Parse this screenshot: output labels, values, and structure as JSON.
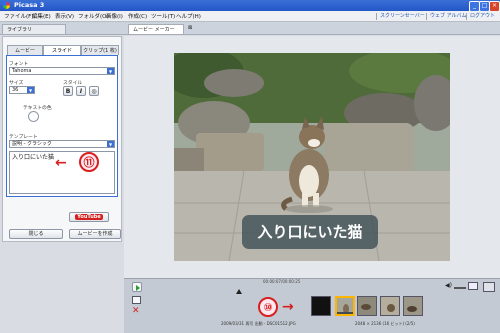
{
  "window": {
    "title": "Picasa 3"
  },
  "menu": {
    "items": [
      "ファイル(F)",
      "編集(E)",
      "表示(V)",
      "フォルダ(O)",
      "画像(I)",
      "作成(C)",
      "ツール(T)",
      "ヘルプ(H)"
    ],
    "links": [
      "スクリーンセーバー",
      "ウェブ アルバム",
      "ログアウト"
    ]
  },
  "doc_tabs": {
    "library": "ライブラリ",
    "movie_maker": "ムービー メーカー"
  },
  "panel": {
    "tabs": [
      "ムービー",
      "スライド",
      "クリップ(1 枚)"
    ],
    "font_label": "フォント",
    "font_value": "Tahoma",
    "size_label": "サイズ",
    "size_value": "36",
    "style_label": "スタイル",
    "style_buttons": [
      "B",
      "I",
      "◎"
    ],
    "text_color_label": "テキストの色",
    "template_label": "テンプレート",
    "template_value": "説明 - クラシック",
    "caption_text": "入り口にいた猫",
    "youtube_label": "YouTube",
    "close_button": "閉じる",
    "create_movie_button": "ムービーを作成"
  },
  "preview": {
    "caption": "入り口にいた猫"
  },
  "timeline": {
    "time_readout": "00:00:07/00:00:25",
    "status_left": "2009/03/31 再写 出動 - DSC01512.JPG",
    "status_right": "2048 × 2136 (16 ビット) (2/5)"
  },
  "annotations": {
    "callout_11": "⑪",
    "callout_10": "⑩"
  },
  "colors": {
    "accent": "#3b6fd2",
    "callout": "#d62020",
    "selected_thumb": "#ffb400"
  }
}
